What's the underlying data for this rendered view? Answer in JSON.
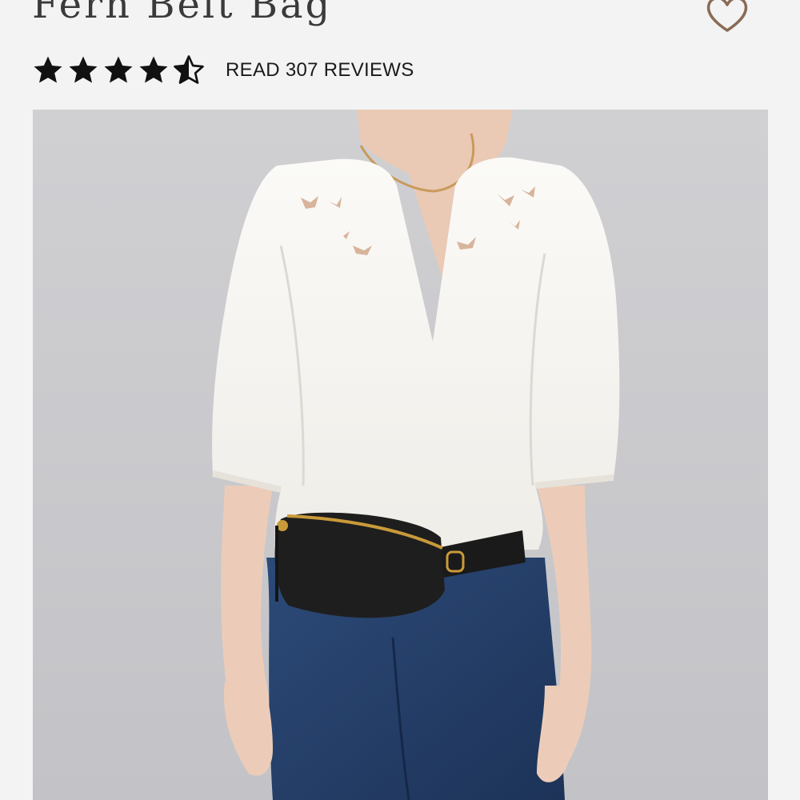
{
  "product": {
    "title": "Fern Belt Bag",
    "rating": 4.5,
    "rating_max": 5,
    "reviews_link_label": "READ 307 REVIEWS"
  },
  "icons": {
    "favorite": "heart-outline-icon",
    "star_full": "star-filled-icon",
    "star_half": "star-half-icon"
  },
  "colors": {
    "background": "#f3f3f3",
    "heart_stroke": "#8a6b55",
    "star_fill": "#111111",
    "title_text": "#3a3a3a"
  }
}
